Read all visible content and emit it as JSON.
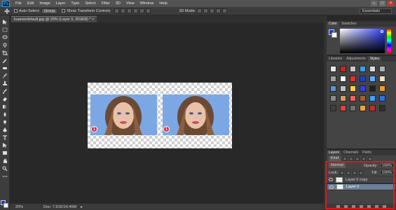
{
  "app": {
    "logo_text": "Ps"
  },
  "menu": [
    "File",
    "Edit",
    "Image",
    "Layer",
    "Type",
    "Select",
    "Filter",
    "3D",
    "View",
    "Window",
    "Help"
  ],
  "window_controls": [
    "–",
    "□",
    "×"
  ],
  "options": {
    "auto_select_label": "Auto-Select:",
    "auto_select_value": "Group",
    "show_transform_label": "Show Transform Controls",
    "mode_label": "3D Mode:",
    "workspace": "Essentials"
  },
  "document": {
    "tab_title": "kuansedefault.jpg @ 20% (Layer 0, RGB/8) *  ×"
  },
  "canvas": {
    "badge1": "1",
    "badge2": "1"
  },
  "status": {
    "zoom": "20%",
    "doc_info": "Doc: 7.91K/14.40M",
    "arrow": "▸"
  },
  "color_panel": {
    "tabs": [
      "Color",
      "Swatches"
    ],
    "fg_color": "#1f3bd8",
    "bg_color": "#ffffff"
  },
  "styles_panel": {
    "tabs": [
      "Libraries",
      "Adjustments",
      "Styles"
    ],
    "swatches": [
      "#e8e8e8",
      "#d02020",
      "#c8c8c8",
      "#3aa0e0",
      "#dcdcdc",
      "#b0b0b0",
      "#a0a0a0",
      "#ffffff",
      "#e03030",
      "#2040c0",
      "#5fb0ff",
      "#f0e0c0",
      "#6090d0",
      "#c0c0c0",
      "#ffd040",
      "#3040e0",
      "#202020",
      "#e8a030",
      "#8a8a8a",
      "#d0a060",
      "#f06060",
      "#a06030",
      "#40a0ff",
      "#3070e0",
      "#404040",
      "#e04040",
      "#707070",
      "#f0a040",
      "#c03030",
      "#303030"
    ]
  },
  "layers_panel": {
    "tabs": [
      "Layers",
      "Channels",
      "Paths"
    ],
    "kind_label": "Kind",
    "blend_mode": "Normal",
    "opacity_label": "Opacity:",
    "opacity_value": "100%",
    "lock_label": "Lock:",
    "fill_label": "Fill:",
    "fill_value": "100%",
    "layers": [
      {
        "name": "Layer 0 copy",
        "selected": false
      },
      {
        "name": "Layer 0",
        "selected": true
      }
    ]
  }
}
